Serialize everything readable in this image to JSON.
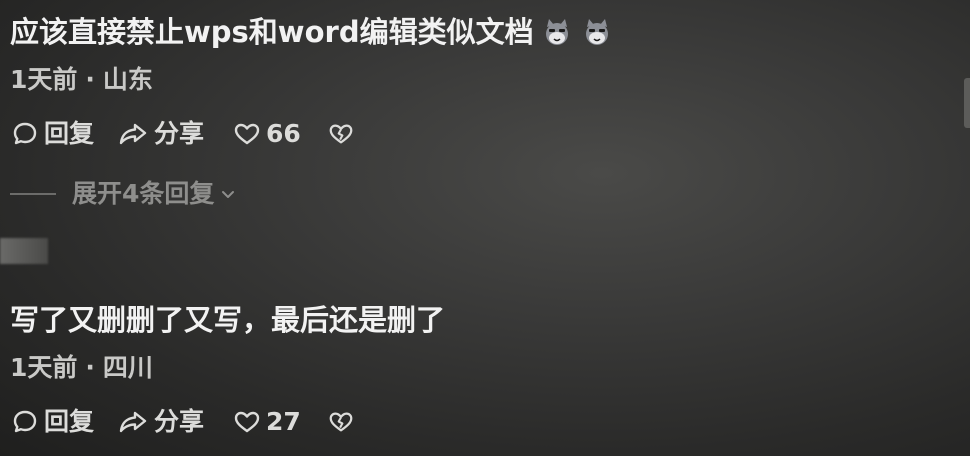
{
  "comments": [
    {
      "text": "应该直接禁止wps和word编辑类似文档",
      "emojis": [
        "cat-face-emoji",
        "cat-face-emoji"
      ],
      "time": "1天前",
      "separator": "·",
      "location": "山东",
      "reply_label": "回复",
      "share_label": "分享",
      "likes": "66"
    },
    {
      "text": "写了又删删了又写，最后还是删了",
      "time": "1天前",
      "separator": "·",
      "location": "四川",
      "reply_label": "回复",
      "share_label": "分享",
      "likes": "27"
    }
  ],
  "expand_replies": "展开4条回复",
  "icons": {
    "reply": "speech-bubble-icon",
    "share": "share-arrow-icon",
    "like": "heart-outline-icon",
    "dislike": "broken-heart-icon",
    "expand": "chevron-down-icon"
  },
  "colors": {
    "background": "#333332",
    "text_primary": "#f2f2f2",
    "text_secondary": "#c9c9c7",
    "text_muted": "#8e8e8c"
  }
}
